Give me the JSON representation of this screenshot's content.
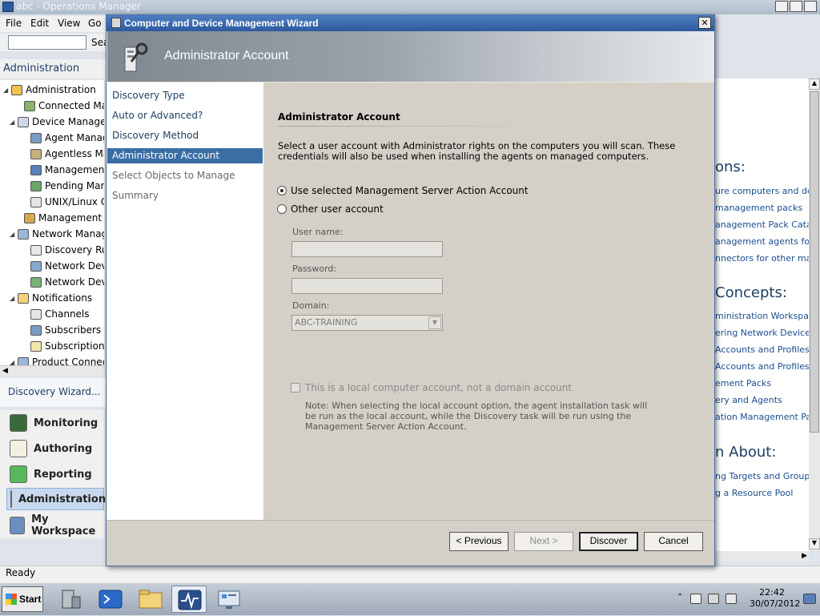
{
  "app": {
    "title": "abc - Operations Manager",
    "menu": [
      "File",
      "Edit",
      "View",
      "Go"
    ],
    "search_label": "Sea",
    "search_value": "",
    "nav_header": "Administration",
    "tree": [
      {
        "label": "Administration",
        "level": 0,
        "expander": "collapse"
      },
      {
        "label": "Connected Management Groups",
        "level": 1,
        "expander": "none"
      },
      {
        "label": "Device Management",
        "level": 1,
        "expander": "collapse"
      },
      {
        "label": "Agent Managed",
        "level": 2,
        "expander": "none"
      },
      {
        "label": "Agentless Managed",
        "level": 2,
        "expander": "none"
      },
      {
        "label": "Management Servers",
        "level": 2,
        "expander": "none"
      },
      {
        "label": "Pending Management",
        "level": 2,
        "expander": "none"
      },
      {
        "label": "UNIX/Linux Computers",
        "level": 2,
        "expander": "none"
      },
      {
        "label": "Management Packs",
        "level": 1,
        "expander": "none"
      },
      {
        "label": "Network Management",
        "level": 1,
        "expander": "collapse"
      },
      {
        "label": "Discovery Rules",
        "level": 2,
        "expander": "none"
      },
      {
        "label": "Network Devices",
        "level": 2,
        "expander": "none"
      },
      {
        "label": "Network Devices Pending Management",
        "level": 2,
        "expander": "none"
      },
      {
        "label": "Notifications",
        "level": 1,
        "expander": "collapse"
      },
      {
        "label": "Channels",
        "level": 2,
        "expander": "none"
      },
      {
        "label": "Subscribers",
        "level": 2,
        "expander": "none"
      },
      {
        "label": "Subscriptions",
        "level": 2,
        "expander": "none"
      },
      {
        "label": "Product Connectors",
        "level": 1,
        "expander": "collapse"
      }
    ],
    "action_link": "Discovery Wizard...",
    "wunderbar": [
      {
        "label": "Monitoring",
        "icon": "monitoring-icon",
        "active": false
      },
      {
        "label": "Authoring",
        "icon": "authoring-icon",
        "active": false
      },
      {
        "label": "Reporting",
        "icon": "reporting-icon",
        "active": false
      },
      {
        "label": "Administration",
        "icon": "administration-icon",
        "active": true
      },
      {
        "label": "My Workspace",
        "icon": "my-workspace-icon",
        "active": false
      }
    ],
    "status": "Ready",
    "right_pane": {
      "sections": [
        {
          "heading": "ons:",
          "links": [
            "ure computers and dev",
            "management packs",
            "anagement Pack Catal",
            "anagement agents for c",
            "nnectors for other man"
          ]
        },
        {
          "heading": "Concepts:",
          "links": [
            "ministration Workspac",
            "ering Network Devices",
            "Accounts and Profiles",
            "Accounts and Profiles f",
            "ement Packs",
            "ery and Agents",
            "ation Management Pack"
          ]
        },
        {
          "heading": "n About:",
          "links": [
            "ng Targets and Groups",
            "g a Resource Pool"
          ]
        }
      ]
    }
  },
  "wizard": {
    "title": "Computer and Device Management Wizard",
    "banner_title": "Administrator Account",
    "steps": [
      {
        "label": "Discovery Type",
        "state": "done"
      },
      {
        "label": "Auto or Advanced?",
        "state": "done"
      },
      {
        "label": "Discovery Method",
        "state": "done"
      },
      {
        "label": "Administrator Account",
        "state": "current"
      },
      {
        "label": "Select Objects to Manage",
        "state": "future"
      },
      {
        "label": "Summary",
        "state": "future"
      }
    ],
    "heading": "Administrator Account",
    "description": "Select a user account with Administrator rights on the computers you will scan. These credentials will also be used when installing the agents on managed computers.",
    "radio_action_account": "Use selected Management Server Action Account",
    "radio_other": "Other user account",
    "selected_option": "action_account",
    "username_label": "User name:",
    "username_value": "",
    "password_label": "Password:",
    "password_value": "",
    "domain_label": "Domain:",
    "domain_value": "ABC-TRAINING",
    "local_account_label": "This is a local computer account, not a domain account",
    "note": "Note:  When selecting the local account option, the agent installation task will be run as the local account, while the Discovery task will be run using the Management Server Action Account.",
    "buttons": {
      "previous": "< Previous",
      "next": "Next >",
      "discover": "Discover",
      "cancel": "Cancel"
    }
  },
  "taskbar": {
    "start_label": "Start",
    "apps": [
      "server-manager-icon",
      "powershell-icon",
      "explorer-icon",
      "operations-manager-icon",
      "remote-desktop-icon"
    ],
    "active_app": "operations-manager-icon",
    "time": "22:42",
    "date": "30/07/2012"
  },
  "colors": {
    "selection": "#3a6ea5",
    "title_bar": "#2d5a9e",
    "link": "#1a4d8f"
  }
}
